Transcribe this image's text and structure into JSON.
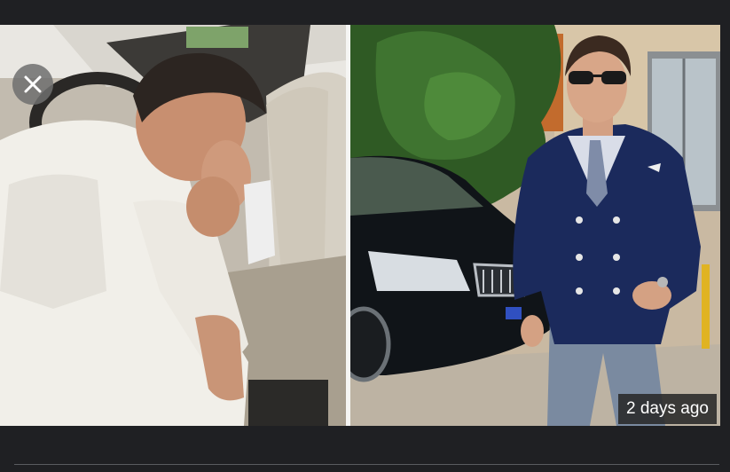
{
  "viewer": {
    "timestamp": "2 days ago",
    "close_icon": "close-icon"
  },
  "colors": {
    "background": "#1f2023",
    "close_button": "#6e6e6e",
    "timestamp_bg": "#282828",
    "timestamp_text": "#ffffff"
  }
}
